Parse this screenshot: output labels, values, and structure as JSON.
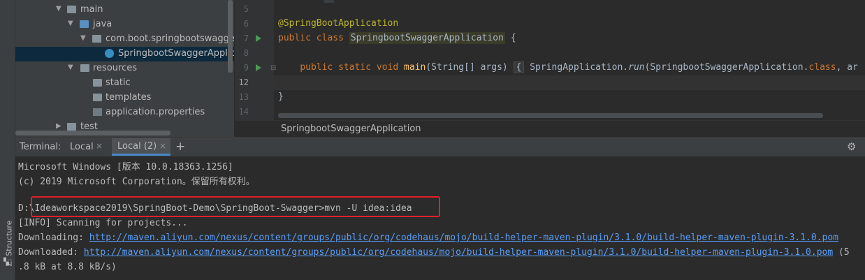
{
  "project_tree": {
    "items": [
      {
        "label": "main",
        "type": "folder",
        "expanded": true
      },
      {
        "label": "java",
        "type": "source-folder",
        "expanded": true
      },
      {
        "label": "com.boot.springbootswagger",
        "type": "package",
        "expanded": true
      },
      {
        "label": "SpringbootSwaggerApplicati",
        "type": "spring-boot-class",
        "selected": true
      },
      {
        "label": "resources",
        "type": "resources-folder",
        "expanded": true
      },
      {
        "label": "static",
        "type": "folder"
      },
      {
        "label": "templates",
        "type": "folder"
      },
      {
        "label": "application.properties",
        "type": "properties-file"
      },
      {
        "label": "test",
        "type": "folder",
        "expanded": false
      }
    ]
  },
  "editor": {
    "line_numbers": [
      "5",
      "6",
      "7",
      "8",
      "9",
      "12",
      "13",
      "14"
    ],
    "lines": {
      "l6_annotation": "@SpringBootApplication",
      "l7_kw": "public class ",
      "l7_class": "SpringbootSwaggerApplication",
      "l7_brace": " {",
      "l9_kw": "public static void ",
      "l9_method": "main",
      "l9_params": "(String[] args) ",
      "l9_fold": "{",
      "l9_call_a": " SpringApplication.",
      "l9_call_run": "run",
      "l9_call_b": "(SpringbootSwaggerApplication.",
      "l9_call_kw": "class",
      "l9_call_c": ", ar",
      "l13_brace": "}"
    },
    "breadcrumb": "SpringbootSwaggerApplication"
  },
  "terminal": {
    "title": "Terminal:",
    "tabs": [
      {
        "label": "Local",
        "active": false
      },
      {
        "label": "Local (2)",
        "active": true
      }
    ],
    "add_label": "+",
    "close_glyph": "×",
    "gear_glyph": "⚙",
    "lines": {
      "l1": "Microsoft Windows [版本 10.0.18363.1256]",
      "l2": "(c) 2019 Microsoft Corporation。保留所有权利。",
      "l4": "D:\\Ideaworkspace2019\\SpringBoot-Demo\\SpringBoot-Swagger>mvn -U idea:idea",
      "l5": "[INFO] Scanning for projects...",
      "l6_prefix": "Downloading: ",
      "l6_link": "http://maven.aliyun.com/nexus/content/groups/public/org/codehaus/mojo/build-helper-maven-plugin/3.1.0/build-helper-maven-plugin-3.1.0.pom",
      "l7_prefix": "Downloaded: ",
      "l7_link": "http://maven.aliyun.com/nexus/content/groups/public/org/codehaus/mojo/build-helper-maven-plugin/3.1.0/build-helper-maven-plugin-3.1.0.pom",
      "l7_suffix": " (5",
      "l8": ".8 kB at 8.8 kB/s)"
    }
  },
  "side_tools": {
    "structure_label": "Z: Structure"
  },
  "colors": {
    "highlight_box": "#e0202a",
    "link": "#589df6",
    "keyword": "#cc7832",
    "annotation": "#bbb529"
  }
}
